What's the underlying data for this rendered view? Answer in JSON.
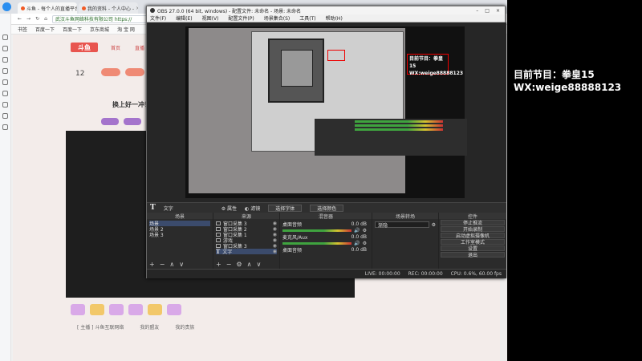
{
  "browser": {
    "tabs": [
      {
        "label": "斗鱼 - 每个人的直播平台",
        "active": true
      },
      {
        "label": "我的资料 - 个人中心 -",
        "active": false
      }
    ],
    "address": "武汉斗鱼网络科技有限公司 https://",
    "bookmarks": [
      "书签",
      "百度一下",
      "百度一下",
      "京东商城",
      "淘 宝 网"
    ],
    "site": {
      "logo": "斗鱼",
      "nav": [
        "首页",
        "直播"
      ],
      "stat": "12",
      "banner": "换上好一冲！",
      "footer": [
        "[ 主播 ] 斗鱼互联网络",
        "我的盟友",
        "我的贵族"
      ]
    }
  },
  "obs": {
    "title": "OBS 27.0.0 (64 bit, windows) - 配置文件: 未命名 - 场景: 未命名",
    "menu": [
      "文件(F)",
      "编辑(E)",
      "视图(V)",
      "配置文件(P)",
      "场景集合(S)",
      "工具(T)",
      "帮助(H)"
    ],
    "preview_overlay": {
      "line1": "目前节目：拳皇15",
      "line2": "WX:weige88888123"
    },
    "source_toolbar": {
      "source": "文字",
      "properties": "属性",
      "filters": "滤镜",
      "select_font": "选择字体",
      "select_color": "选择颜色"
    },
    "docks": {
      "scenes": {
        "header": "场景",
        "items": [
          "场景",
          "场景 2",
          "场景 3"
        ]
      },
      "sources": {
        "header": "来源",
        "items": [
          "窗口采集 3",
          "窗口采集 2",
          "窗口采集 1",
          "游戏",
          "窗口采集 3",
          "文字"
        ]
      },
      "mixer": {
        "header": "混音器",
        "channels": [
          {
            "name": "桌面音频",
            "db": "0.0 dB"
          },
          {
            "name": "麦克风/Aux",
            "db": "0.0 dB"
          },
          {
            "name": "桌面音频",
            "db": "0.0 dB"
          }
        ]
      },
      "transitions": {
        "header": "场景转场",
        "type": "渐隐"
      },
      "controls": {
        "header": "控件",
        "buttons": [
          "停止推流",
          "开始录制",
          "启动虚拟摄像机",
          "工作室模式",
          "设置",
          "退出"
        ]
      }
    },
    "status": {
      "live": "LIVE: 00:00:00",
      "rec": "REC: 00:00:00",
      "cpu": "CPU: 0.6%, 60.00 fps"
    }
  },
  "overlay": {
    "line1": "目前节目：拳皇15",
    "line2": "WX:weige88888123"
  },
  "colors": {
    "obs_bg": "#2b2b2b",
    "accent_red": "#e00000",
    "site_brand": "#e8554f"
  }
}
